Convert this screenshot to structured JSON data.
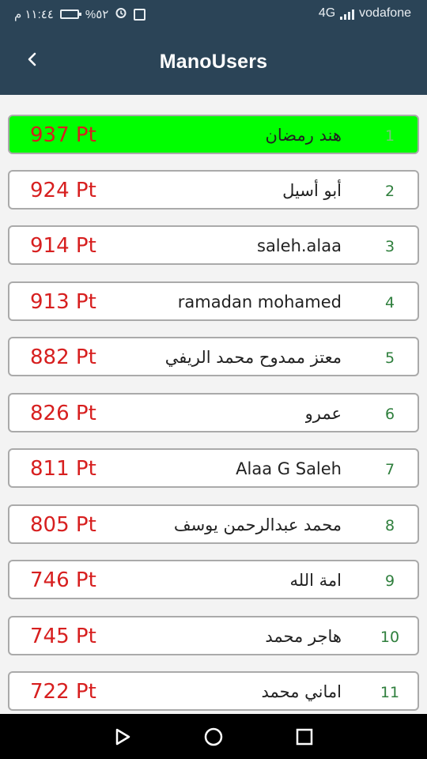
{
  "status_bar": {
    "time": "١١:٤٤ م",
    "battery": "%٥٢",
    "network_label": "vodafone",
    "network_type": "4G"
  },
  "app_bar": {
    "title": "ManoUsers",
    "back_icon": "back-chevron-icon"
  },
  "leaderboard": [
    {
      "rank": "1",
      "name": "هند رمضان",
      "points": "937 Pt"
    },
    {
      "rank": "2",
      "name": "أبو أسيل",
      "points": "924 Pt"
    },
    {
      "rank": "3",
      "name": "saleh.alaa",
      "points": "914 Pt"
    },
    {
      "rank": "4",
      "name": "ramadan mohamed",
      "points": "913 Pt"
    },
    {
      "rank": "5",
      "name": "معتز ممدوح محمد الريفي",
      "points": "882 Pt"
    },
    {
      "rank": "6",
      "name": "عمرو",
      "points": "826 Pt"
    },
    {
      "rank": "7",
      "name": "Alaa G Saleh",
      "points": "811 Pt"
    },
    {
      "rank": "8",
      "name": "محمد عبدالرحمن يوسف",
      "points": "805 Pt"
    },
    {
      "rank": "9",
      "name": "امة الله",
      "points": "746 Pt"
    },
    {
      "rank": "10",
      "name": "هاجر محمد",
      "points": "745 Pt"
    },
    {
      "rank": "11",
      "name": "اماني محمد",
      "points": "722 Pt"
    }
  ],
  "colors": {
    "app_bar": "#2b4457",
    "highlight": "#00ff00",
    "points": "#d71f1f",
    "rank": "#2f7f3d"
  }
}
